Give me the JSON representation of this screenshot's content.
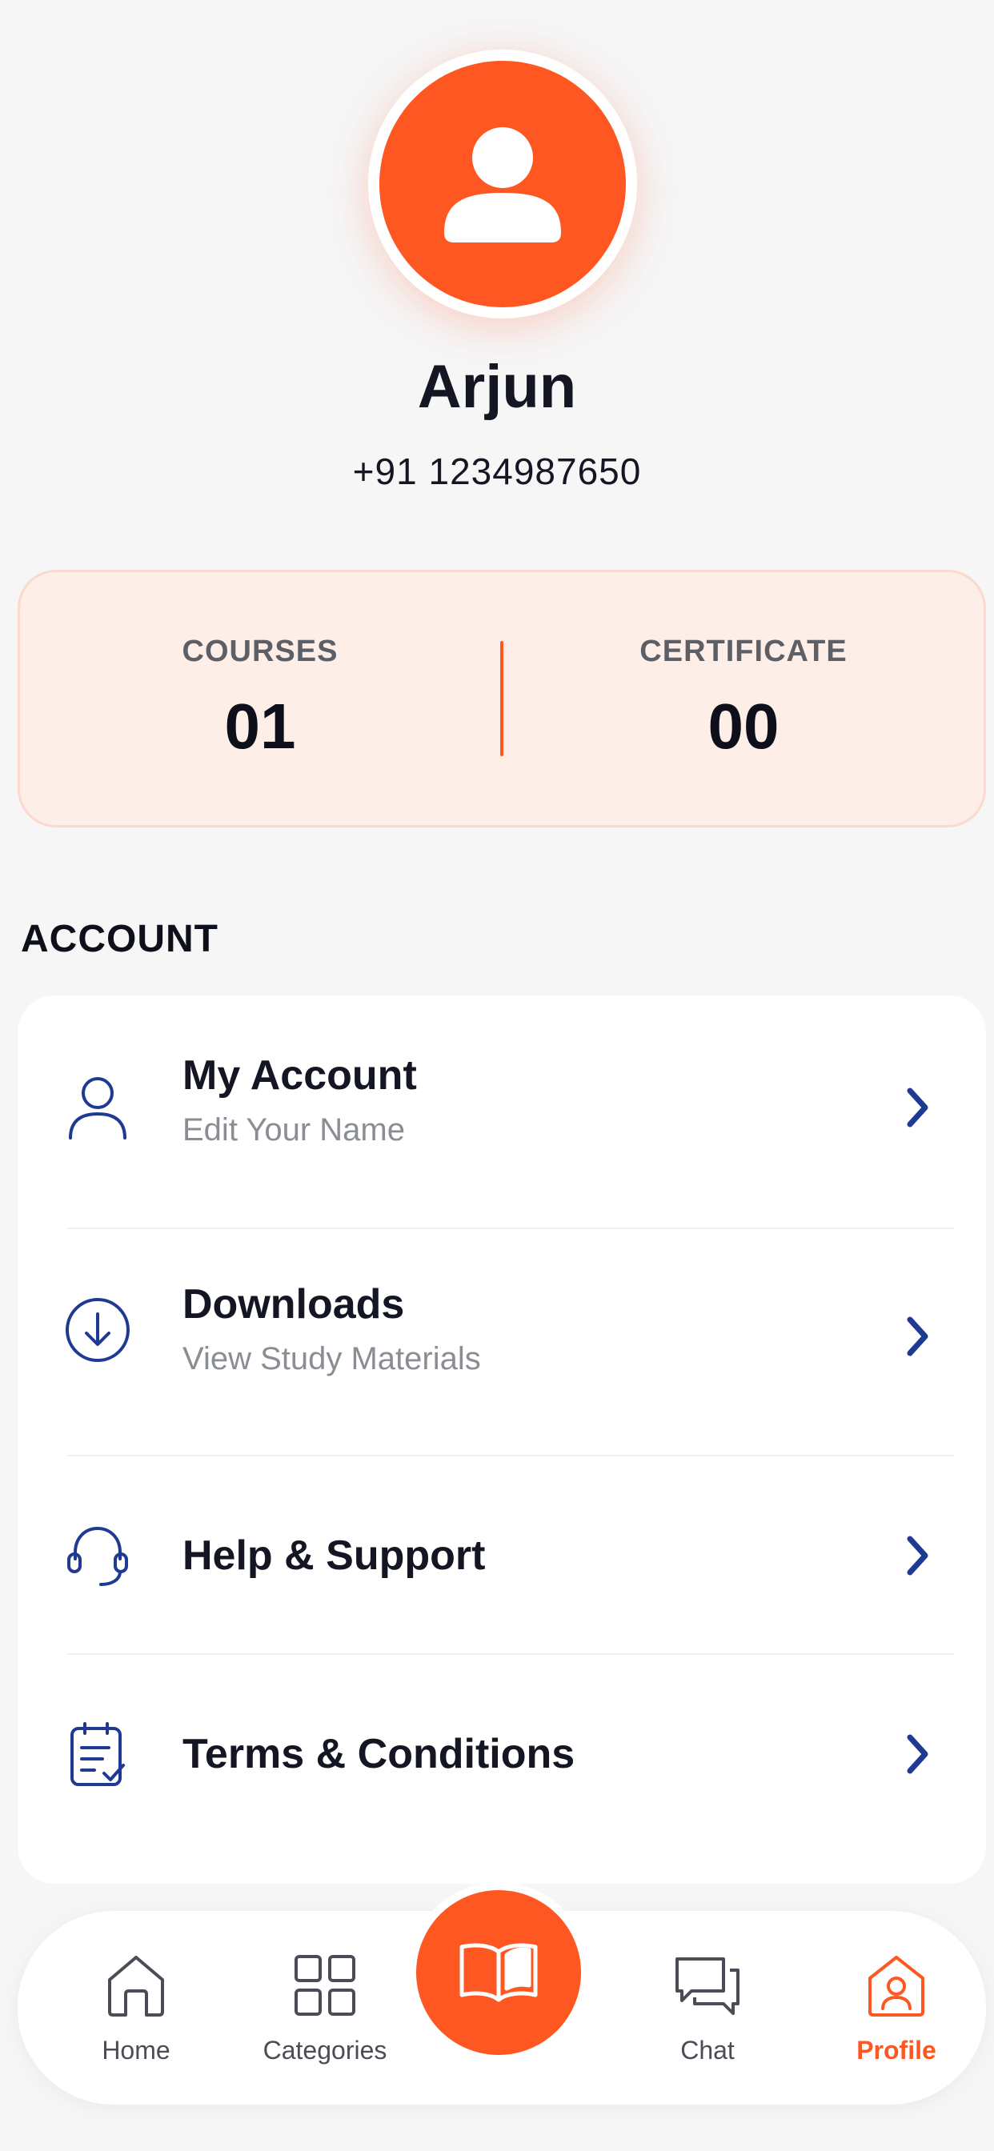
{
  "profile": {
    "name": "Arjun",
    "phone": "+91 1234987650"
  },
  "stats": {
    "courses": {
      "label": "COURSES",
      "value": "01"
    },
    "certificate": {
      "label": "CERTIFICATE",
      "value": "00"
    }
  },
  "account": {
    "section_title": "ACCOUNT",
    "items": [
      {
        "title": "My Account",
        "subtitle": "Edit Your Name",
        "icon": "user-icon"
      },
      {
        "title": "Downloads",
        "subtitle": "View Study Materials",
        "icon": "download-icon"
      },
      {
        "title": "Help & Support",
        "subtitle": "",
        "icon": "headset-icon"
      },
      {
        "title": "Terms & Conditions",
        "subtitle": "",
        "icon": "document-check-icon"
      }
    ]
  },
  "bottom_nav": {
    "items": [
      {
        "label": "Home",
        "icon": "home-icon",
        "active": false
      },
      {
        "label": "Categories",
        "icon": "grid-icon",
        "active": false
      },
      {
        "label": "",
        "icon": "book-icon",
        "active": false
      },
      {
        "label": "Chat",
        "icon": "chat-icon",
        "active": false
      },
      {
        "label": "Profile",
        "icon": "profile-icon",
        "active": true
      }
    ]
  },
  "colors": {
    "accent": "#ff5722",
    "accent_soft": "#fdeee8",
    "icon_blue": "#1f3a93",
    "text_dark": "#141624",
    "text_muted": "#8a8d93"
  }
}
